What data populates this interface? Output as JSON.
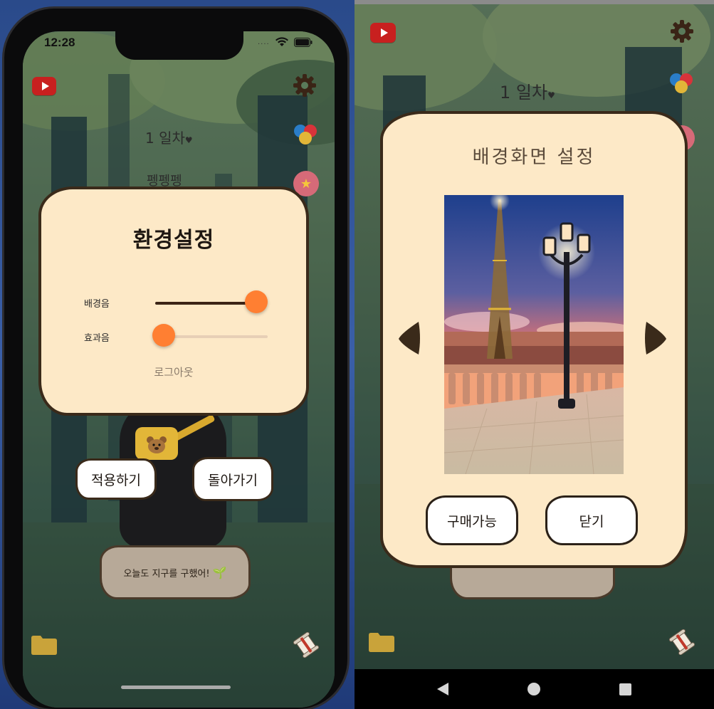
{
  "left_phone": {
    "status": {
      "time": "12:28",
      "signal_dots": "....",
      "wifi_icon": "wifi-icon",
      "battery_icon": "battery-icon"
    },
    "top_icons": [
      "youtube-icon",
      "gear-icon",
      "color-palette-icon",
      "star-badge-icon"
    ],
    "day_label": "1 일차",
    "day_heart": "♥",
    "name_label": "펭펭펭",
    "settings": {
      "title": "환경설정",
      "bgm_label": "배경음",
      "bgm_level": 1.0,
      "sfx_label": "효과음",
      "sfx_level": 0.0,
      "logout_label": "로그아웃"
    },
    "buttons": {
      "apply": "적용하기",
      "back": "돌아가기"
    },
    "quote": "오늘도 지구를 구했어!",
    "bottom_icons": [
      "folder-icon",
      "scroll-icon"
    ]
  },
  "right_phone": {
    "top_icons": [
      "youtube-icon",
      "gear-icon",
      "color-palette-icon",
      "star-badge-icon"
    ],
    "day_label": "1 일차",
    "day_heart": "♥",
    "background_settings": {
      "title": "배경화면 설정",
      "preview_subject": "eiffel-tower-lamp-night-scene",
      "buy_button": "구매가능",
      "close_button": "닫기"
    },
    "bottom_icons": [
      "folder-icon",
      "scroll-icon"
    ],
    "nav": [
      "back-icon",
      "home-icon",
      "recents-icon"
    ]
  },
  "colors": {
    "modal_bg": "#fde9c7",
    "modal_border": "#3a2a1a",
    "slider_thumb": "#ff7f32",
    "slider_active": "#3b2416",
    "youtube_red": "#c8201f"
  }
}
